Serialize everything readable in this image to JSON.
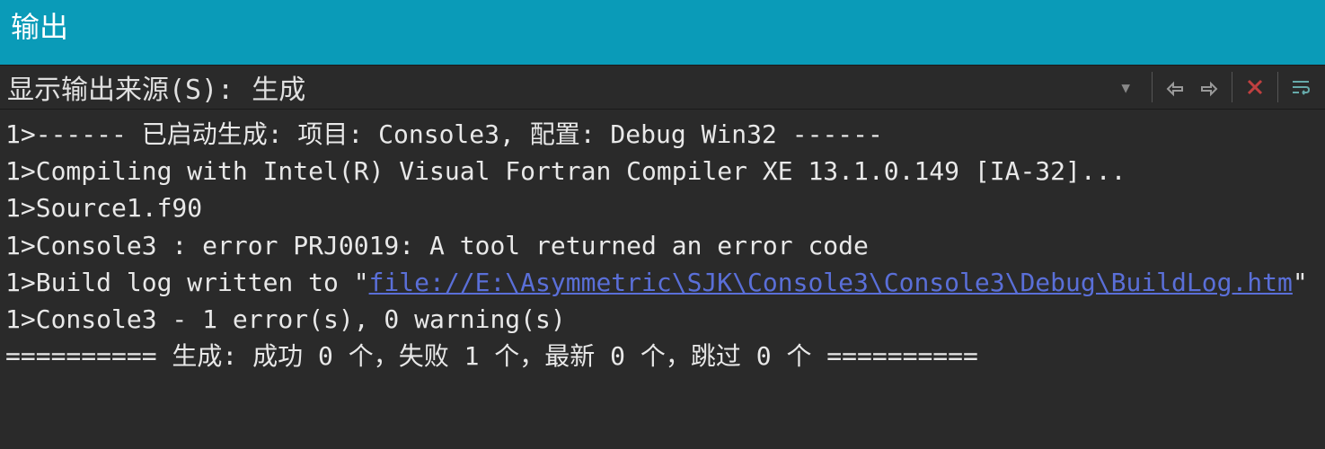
{
  "panel": {
    "title": "输出"
  },
  "toolbar": {
    "source_label": "显示输出来源(S):",
    "source_value": "生成"
  },
  "output": {
    "lines": [
      {
        "prefix": "1>------ 已启动生成: 项目: Console3, 配置: Debug Win32 ------"
      },
      {
        "prefix": "1>Compiling with Intel(R) Visual Fortran Compiler XE 13.1.0.149 [IA-32]..."
      },
      {
        "prefix": "1>Source1.f90"
      },
      {
        "prefix": "1>Console3 : error PRJ0019: A tool returned an error code"
      },
      {
        "prefix": "1>Build log written to  \"",
        "link": "file://E:\\Asymmetric\\SJK\\Console3\\Console3\\Debug\\BuildLog.htm",
        "suffix": "\""
      },
      {
        "prefix": "1>Console3 - 1 error(s), 0 warning(s)"
      },
      {
        "prefix": "========== 生成: 成功 0 个，失败 1 个，最新 0 个，跳过 0 个 =========="
      }
    ]
  }
}
